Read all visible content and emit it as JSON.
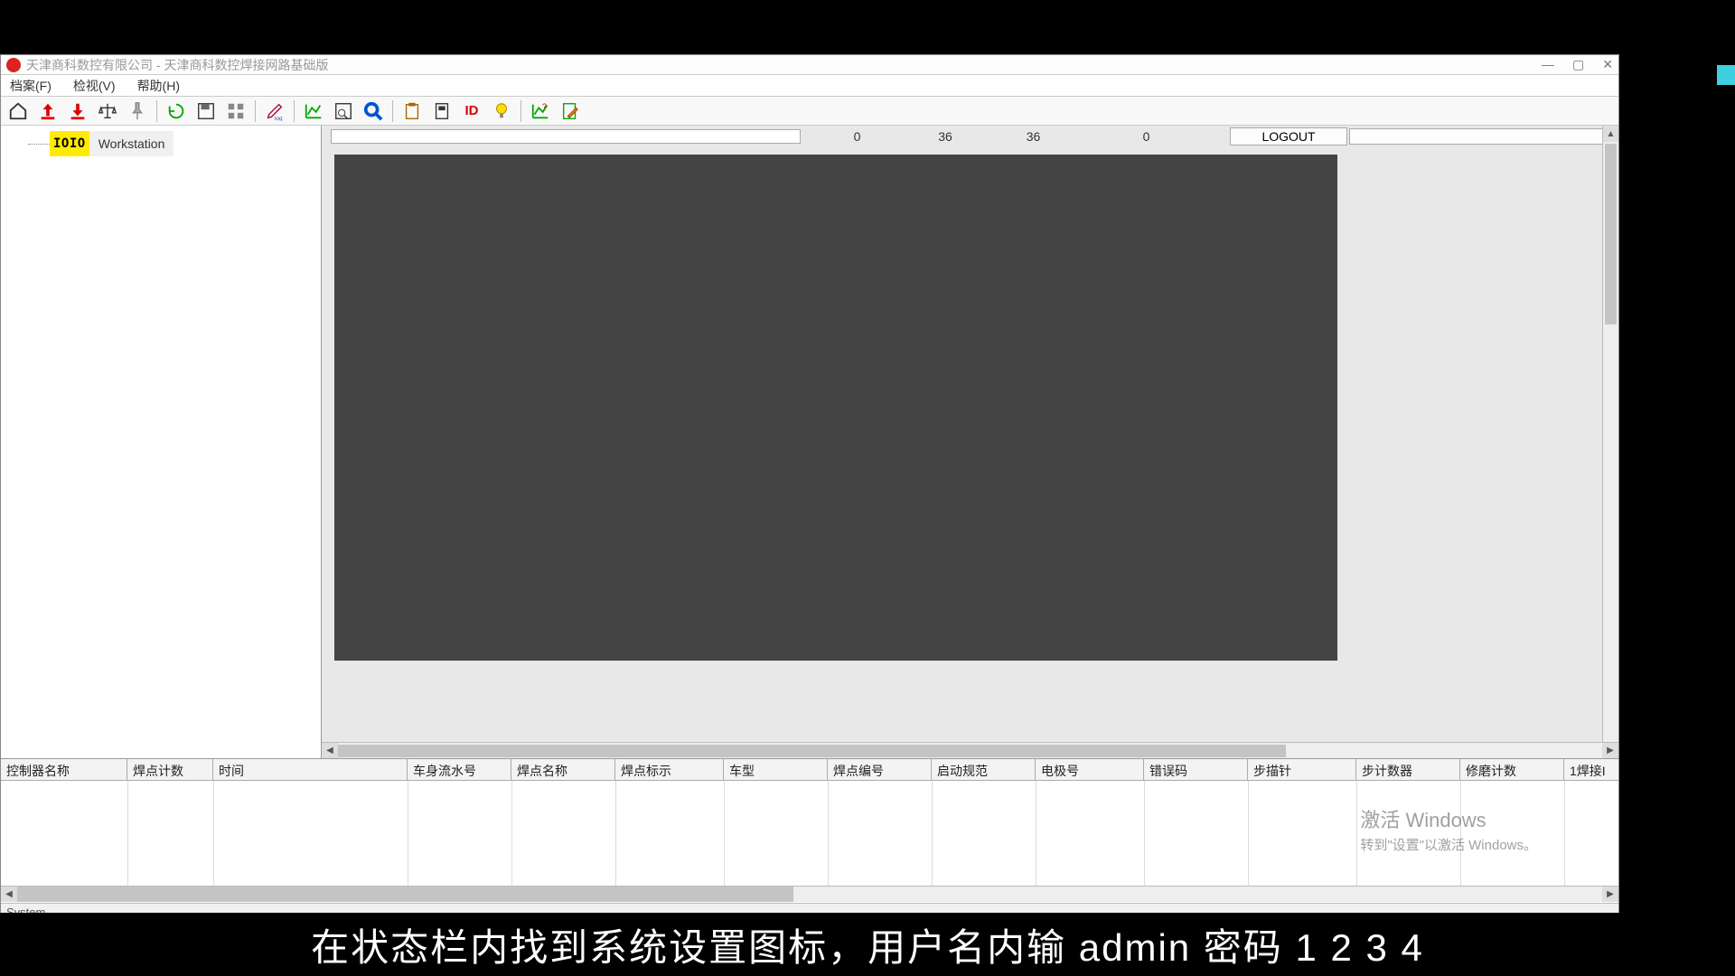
{
  "titlebar": {
    "title": "天津商科数控有限公司 - 天津商科数控焊接网路基础版"
  },
  "menu": {
    "file": "档案(F)",
    "view": "检视(V)",
    "help": "帮助(H)"
  },
  "tree": {
    "badge": "IOIO",
    "node_label": "Workstation"
  },
  "info_row": {
    "v1": "0",
    "v2": "36",
    "v3": "36",
    "v4": "0",
    "logout": "LOGOUT"
  },
  "grid": {
    "columns": [
      "控制器名称",
      "焊点计数",
      "时间",
      "车身流水号",
      "焊点名称",
      "焊点标示",
      "车型",
      "焊点编号",
      "启动规范",
      "电极号",
      "错误码",
      "步描针",
      "步计数器",
      "修磨计数",
      "1焊接I"
    ],
    "widths": [
      140,
      95,
      215,
      115,
      115,
      120,
      115,
      115,
      115,
      120,
      115,
      120,
      115,
      115,
      70
    ]
  },
  "statusbar": {
    "text": "System"
  },
  "watermark": {
    "line1": "激活 Windows",
    "line2": "转到\"设置\"以激活 Windows。"
  },
  "subtitle": "在状态栏内找到系统设置图标，用户名内输 admin  密码 1 2 3 4",
  "icons": {
    "home": "home-icon",
    "up": "upload-icon",
    "down": "download-icon",
    "balance": "balance-icon",
    "pin": "pin-icon",
    "recycle": "recycle-icon",
    "disk": "disk-icon",
    "grid": "grid-icon",
    "pen": "pen-icon",
    "chart": "chart-icon",
    "preview": "preview-icon",
    "search": "search-icon",
    "clip": "clipboard-icon",
    "doc": "document-icon",
    "id": "id-icon",
    "bulb": "bulb-icon",
    "chart2": "chart-q-icon",
    "edit": "edit-doc-icon"
  }
}
